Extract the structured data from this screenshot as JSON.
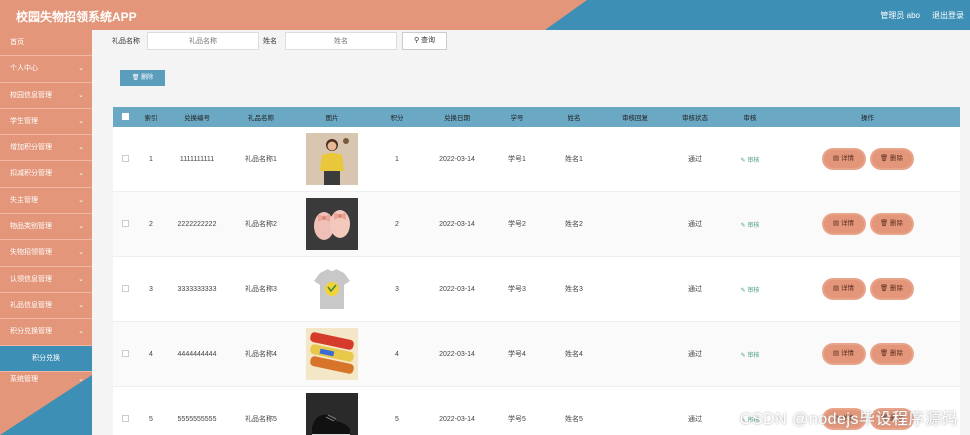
{
  "header": {
    "title": "校园失物招领系统APP",
    "user": "管理员 abo",
    "logout": "退出登录"
  },
  "sidebar": {
    "items": [
      {
        "label": "首页",
        "chevron": false
      },
      {
        "label": "个人中心",
        "chevron": true
      },
      {
        "label": "校园信息管理",
        "chevron": true
      },
      {
        "label": "学生管理",
        "chevron": true
      },
      {
        "label": "增加积分管理",
        "chevron": true
      },
      {
        "label": "扣减积分管理",
        "chevron": true
      },
      {
        "label": "失主管理",
        "chevron": true
      },
      {
        "label": "物品类别管理",
        "chevron": true
      },
      {
        "label": "失物招领管理",
        "chevron": true
      },
      {
        "label": "认领信息管理",
        "chevron": true
      },
      {
        "label": "礼品信息管理",
        "chevron": true
      },
      {
        "label": "积分兑换管理",
        "chevron": true
      }
    ],
    "active_sub": "积分兑换",
    "last": "系统管理"
  },
  "search": {
    "gift_label": "礼品名称",
    "gift_placeholder": "礼品名称",
    "name_label": "姓名",
    "name_placeholder": "姓名",
    "query_button": "查询"
  },
  "toolbar": {
    "delete_label": "删除"
  },
  "table": {
    "columns": [
      "索引",
      "兑换编号",
      "礼品名称",
      "图片",
      "积分",
      "兑换日期",
      "学号",
      "姓名",
      "审核回复",
      "审核状态",
      "审核",
      "操作"
    ],
    "audit_label": "审核",
    "detail_label": "详情",
    "delete_label": "删除",
    "rows": [
      {
        "index": "1",
        "code": "1111111111",
        "gift": "礼品名称1",
        "points": "1",
        "date": "2022-03-14",
        "sid": "学号1",
        "name": "姓名1",
        "reply": "",
        "status": "通过",
        "img": "woman-yellow"
      },
      {
        "index": "2",
        "code": "2222222222",
        "gift": "礼品名称2",
        "points": "2",
        "date": "2022-03-14",
        "sid": "学号2",
        "name": "姓名2",
        "reply": "",
        "status": "通过",
        "img": "pink-shoes"
      },
      {
        "index": "3",
        "code": "3333333333",
        "gift": "礼品名称3",
        "points": "3",
        "date": "2022-03-14",
        "sid": "学号3",
        "name": "姓名3",
        "reply": "",
        "status": "通过",
        "img": "tshirt"
      },
      {
        "index": "4",
        "code": "4444444444",
        "gift": "礼品名称4",
        "points": "4",
        "date": "2022-03-14",
        "sid": "学号4",
        "name": "姓名4",
        "reply": "",
        "status": "通过",
        "img": "snacks"
      },
      {
        "index": "5",
        "code": "5555555555",
        "gift": "礼品名称5",
        "points": "5",
        "date": "2022-03-14",
        "sid": "学号5",
        "name": "姓名5",
        "reply": "",
        "status": "通过",
        "img": "black-shoes"
      }
    ]
  },
  "watermark": "CSDN @nodejs毕设程序源码",
  "colors": {
    "salmon": "#e3967a",
    "blue": "#3d8fb5",
    "header_row": "#6aa8c4"
  }
}
